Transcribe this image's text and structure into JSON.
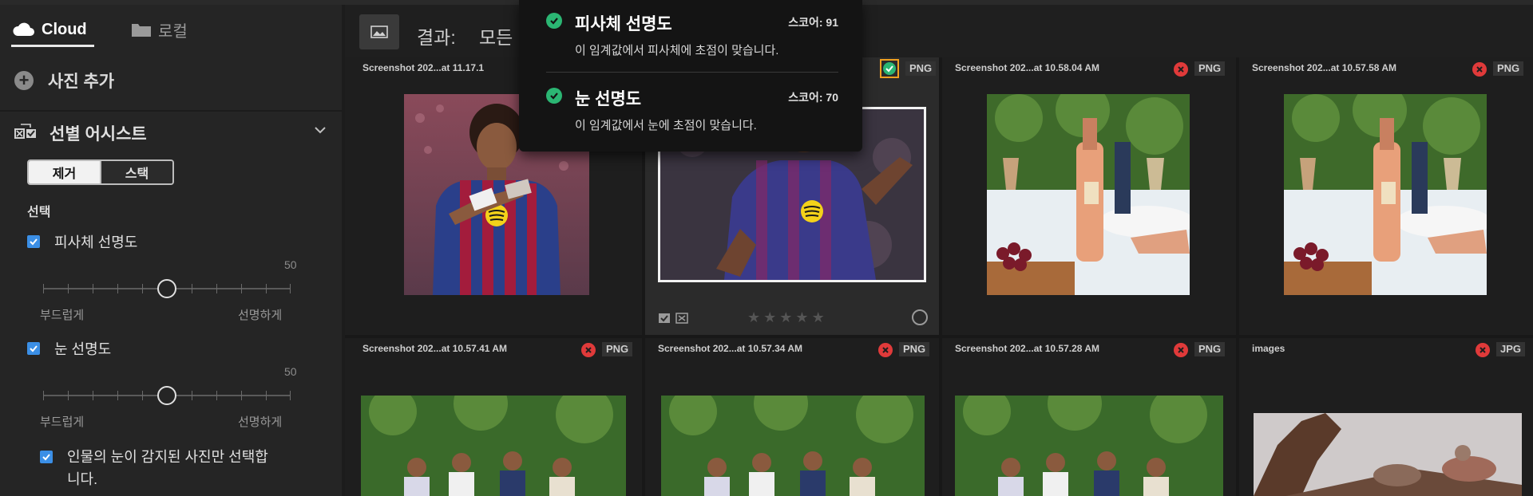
{
  "sidebar": {
    "tabs": [
      {
        "label": "Cloud",
        "icon": "cloud-icon",
        "active": true
      },
      {
        "label": "로컬",
        "icon": "folder-icon",
        "active": false
      }
    ],
    "add_photo": "사진 추가",
    "assist": {
      "title": "선별 어시스트",
      "segments": [
        "제거",
        "스택"
      ],
      "active_segment": "제거",
      "section_label": "선택",
      "criteria": [
        {
          "label": "피사체 선명도",
          "checked": true,
          "value": "50",
          "min_label": "부드럽게",
          "max_label": "선명하게"
        },
        {
          "label": "눈 선명도",
          "checked": true,
          "value": "50",
          "min_label": "부드럽게",
          "max_label": "선명하게"
        }
      ],
      "eye_option": {
        "label_line1": "인물의 눈이 감지된 사진만 선택합",
        "label_line2": "니다.",
        "checked": true
      }
    }
  },
  "toolbar": {
    "result_label": "결과:",
    "result_value": "모든"
  },
  "popup": {
    "items": [
      {
        "title": "피사체 선명도",
        "score": "스코어: 91",
        "description": "이 임계값에서 피사체에 초점이 맞습니다."
      },
      {
        "title": "눈 선명도",
        "score": "스코어: 70",
        "description": "이 임계값에서 눈에 초점이 맞습니다."
      }
    ]
  },
  "grid": {
    "cells": [
      {
        "name": "Screenshot 202...at 11.17.1",
        "status": "hidden",
        "format": ""
      },
      {
        "name": "",
        "status": "ok",
        "format": "PNG",
        "selected": true,
        "rating": 0
      },
      {
        "name": "Screenshot 202...at 10.58.04 AM",
        "status": "reject",
        "format": "PNG"
      },
      {
        "name": "Screenshot 202...at 10.57.58 AM",
        "status": "reject",
        "format": "PNG"
      },
      {
        "name": "Screenshot 202...at 10.57.41 AM",
        "status": "reject",
        "format": "PNG"
      },
      {
        "name": "Screenshot 202...at 10.57.34 AM",
        "status": "reject",
        "format": "PNG"
      },
      {
        "name": "Screenshot 202...at 10.57.28 AM",
        "status": "reject",
        "format": "PNG"
      },
      {
        "name": "images",
        "status": "reject",
        "format": "JPG"
      }
    ]
  },
  "colors": {
    "accent_check": "#3b8fe6",
    "reject": "#e03a3a",
    "ok": "#2bb673",
    "selected_border": "#f0a020"
  }
}
